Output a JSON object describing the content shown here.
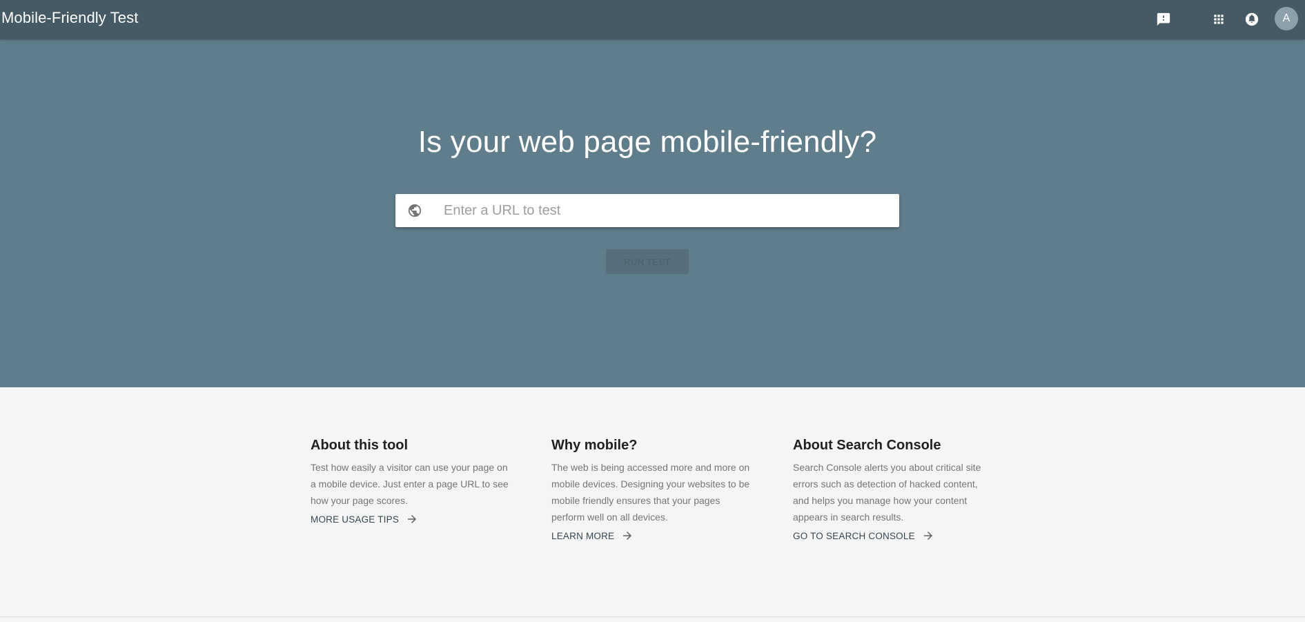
{
  "topbar": {
    "title": "Mobile-Friendly Test",
    "avatar_letter": "A",
    "icons": [
      "feedback-icon",
      "apps-grid-icon",
      "notifications-icon"
    ]
  },
  "hero": {
    "title": "Is your web page mobile-friendly?",
    "url_input": {
      "value": "",
      "placeholder": "Enter a URL to test",
      "icon": "globe-icon"
    },
    "run_button": "RUN TEST"
  },
  "info": [
    {
      "heading": "About this tool",
      "text": "Test how easily a visitor can use your page on a mobile device. Just enter a page URL to see how your page scores.",
      "link": "MORE USAGE TIPS"
    },
    {
      "heading": "Why mobile?",
      "text": "The web is being accessed more and more on mobile devices. Designing your websites to be mobile friendly ensures that your pages perform well on all devices.",
      "link": "LEARN MORE"
    },
    {
      "heading": "About Search Console",
      "text": "Search Console alerts you about critical site errors such as detection of hacked content, and helps you manage how your content appears in search results.",
      "link": "GO TO SEARCH CONSOLE"
    }
  ],
  "colors": {
    "topbar": "#465a65",
    "hero": "#607d8b",
    "page": "#f5f5f5",
    "link": "#37474f"
  }
}
